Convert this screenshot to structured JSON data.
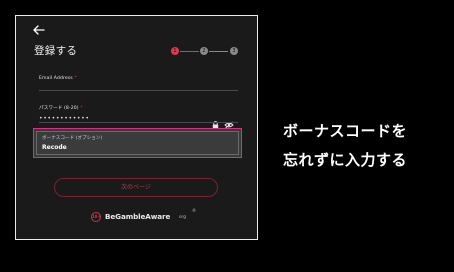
{
  "form": {
    "title": "登録する",
    "steps": [
      {
        "number": "1",
        "state": "active"
      },
      {
        "number": "2",
        "state": "inactive"
      },
      {
        "number": "3",
        "state": "inactive"
      }
    ],
    "email_label": "Email Address",
    "password_label": "パスワード (8-20)",
    "password_value": "••••••••••••",
    "required_marker": "*",
    "bonus_label": "ボーナスコード (オプション)",
    "bonus_value": "Recode",
    "next_button": "次のページ"
  },
  "logo": {
    "mark": "18+",
    "text": "BeGambleAware",
    "suffix": "org",
    "reg": "®"
  },
  "caption": {
    "lines": [
      "ボーナスコードを",
      "忘れずに入力する"
    ]
  },
  "colors": {
    "accent": "#e0364e",
    "highlight": "#e02c86",
    "step_inactive": "#8a8a8a",
    "background": "#000000",
    "panel": "#1a1a1a"
  },
  "icons": {
    "back": "arrow-left-icon",
    "lock": "lock-icon",
    "visibility": "eye-slash-icon"
  }
}
